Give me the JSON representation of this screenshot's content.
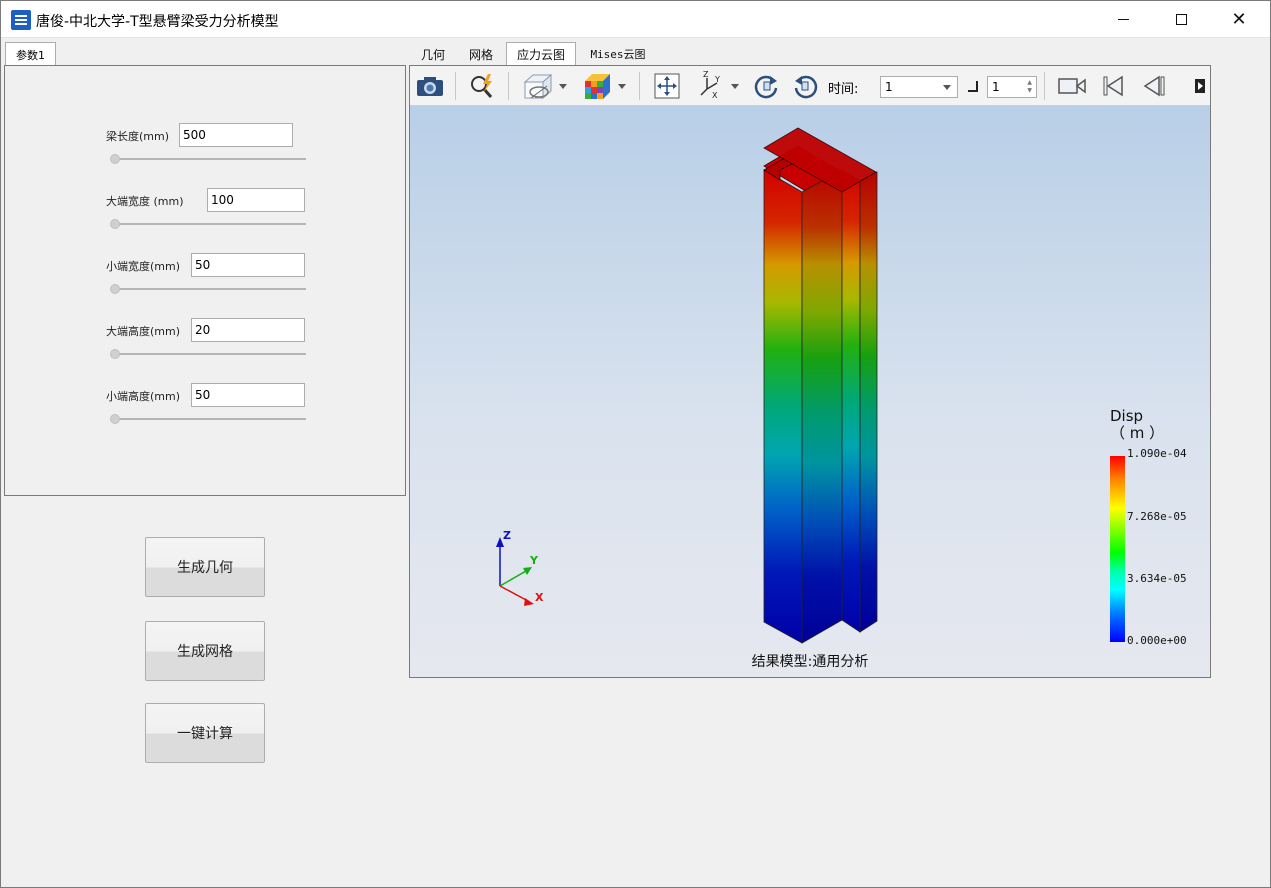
{
  "window": {
    "title": "唐俊-中北大学-T型悬臂梁受力分析模型",
    "minimize": "—",
    "close": "✕"
  },
  "left_panel": {
    "tab": "参数1",
    "params": [
      {
        "label": "梁长度(mm)",
        "value": "500"
      },
      {
        "label": "大端宽度 (mm)",
        "value": "100"
      },
      {
        "label": "小端宽度(mm)",
        "value": "50"
      },
      {
        "label": "大端高度(mm)",
        "value": "20"
      },
      {
        "label": "小端高度(mm)",
        "value": "50"
      }
    ],
    "buttons": {
      "gen_geometry": "生成几何",
      "gen_mesh": "生成网格",
      "compute": "一键计算"
    }
  },
  "view_tabs": [
    "几何",
    "网格",
    "应力云图",
    "Mises云图"
  ],
  "active_tab": "应力云图",
  "toolbar": {
    "time_label": "时间:",
    "time_value": "1",
    "step_value": "1"
  },
  "viewer": {
    "axes": {
      "z": "Z",
      "y": "Y",
      "x": "X"
    },
    "result_label": "结果模型:通用分析",
    "legend": {
      "title": "Disp",
      "unit": "（ m ）",
      "ticks": [
        "1.090e-04",
        "7.268e-05",
        "3.634e-05",
        "0.000e+00"
      ]
    }
  },
  "colors": {
    "high": "#ff0000",
    "low": "#0000cc",
    "background_top": "#b8cfe7",
    "background_bottom": "#e6e8ef"
  }
}
